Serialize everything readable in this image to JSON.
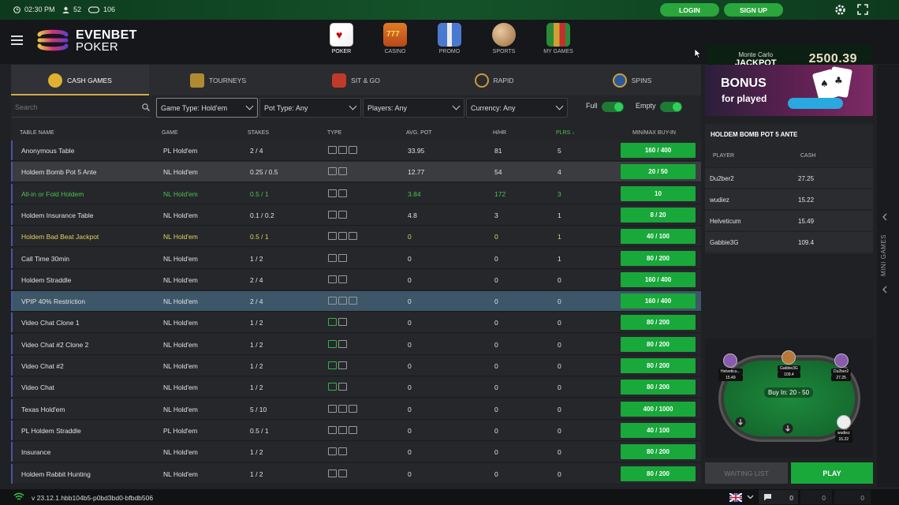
{
  "topbar": {
    "time": "02:30 PM",
    "players": "52",
    "tables": "106",
    "login_label": "LOGIN",
    "signup_label": "SIGN UP"
  },
  "header": {
    "brand_top": "EVENBET",
    "brand_bottom": "POKER",
    "nav": [
      {
        "label": "POKER",
        "icon": "cards-icon"
      },
      {
        "label": "CASINO",
        "icon": "slot-machine-icon"
      },
      {
        "label": "PROMO",
        "icon": "gift-icon"
      },
      {
        "label": "SPORTS",
        "icon": "ball-icon"
      },
      {
        "label": "MY GAMES",
        "icon": "chips-stack-icon"
      }
    ],
    "jackpot": {
      "label_top": "Monte Carlo",
      "label_main": "JACKPOT",
      "value": "2500.39"
    }
  },
  "tabs": [
    {
      "label": "CASH GAMES",
      "icon": "dollar-coin-icon"
    },
    {
      "label": "TOURNEYS",
      "icon": "trophy-icon"
    },
    {
      "label": "SIT & GO",
      "icon": "shield-icon"
    },
    {
      "label": "RAPID",
      "icon": "stopwatch-icon"
    },
    {
      "label": "SPINS",
      "icon": "spin-badge-icon"
    }
  ],
  "filters": {
    "search_placeholder": "Search",
    "game_type": "Game Type: Hold'em",
    "pot_type": "Pot Type: Any",
    "players": "Players: Any",
    "currency": "Currency: Any",
    "full_label": "Full",
    "empty_label": "Empty"
  },
  "columns": [
    "TABLE NAME",
    "GAME",
    "STAKES",
    "TYPE",
    "AVG. POT",
    "H/HR",
    "PLRS ↓",
    "MIN/MAX BUY-IN"
  ],
  "rows": [
    {
      "name": "Anonymous Table",
      "game": "PL Hold'em",
      "stakes": "2 / 4",
      "avg_pot": "33.95",
      "hhr": "81",
      "plrs": "5",
      "buyin": "160 / 400",
      "style": ""
    },
    {
      "name": "Holdem Bomb Pot 5 Ante",
      "game": "NL Hold'em",
      "stakes": "0.25 / 0.5",
      "avg_pot": "12.77",
      "hhr": "54",
      "plrs": "4",
      "buyin": "20 / 50",
      "style": "hl"
    },
    {
      "name": "All-in or Fold Holdem",
      "game": "NL Hold'em",
      "stakes": "0.5 / 1",
      "avg_pot": "3.84",
      "hhr": "172",
      "plrs": "3",
      "buyin": "10",
      "style": "green"
    },
    {
      "name": "Holdem Insurance Table",
      "game": "NL Hold'em",
      "stakes": "0.1 / 0.2",
      "avg_pot": "4.8",
      "hhr": "3",
      "plrs": "1",
      "buyin": "8 / 20",
      "style": ""
    },
    {
      "name": "Holdem Bad Beat Jackpot",
      "game": "NL Hold'em",
      "stakes": "0.5 / 1",
      "avg_pot": "0",
      "hhr": "0",
      "plrs": "1",
      "buyin": "40 / 100",
      "style": "yellow"
    },
    {
      "name": "Call Time 30min",
      "game": "NL Hold'em",
      "stakes": "1 / 2",
      "avg_pot": "0",
      "hhr": "0",
      "plrs": "1",
      "buyin": "80 / 200",
      "style": ""
    },
    {
      "name": "Holdem Straddle",
      "game": "NL Hold'em",
      "stakes": "2 / 4",
      "avg_pot": "0",
      "hhr": "0",
      "plrs": "0",
      "buyin": "160 / 400",
      "style": ""
    },
    {
      "name": "VPIP 40% Restriction",
      "game": "NL Hold'em",
      "stakes": "2 / 4",
      "avg_pot": "0",
      "hhr": "0",
      "plrs": "0",
      "buyin": "160 / 400",
      "style": "sel"
    },
    {
      "name": "Video Chat Clone 1",
      "game": "NL Hold'em",
      "stakes": "1 / 2",
      "avg_pot": "0",
      "hhr": "0",
      "plrs": "0",
      "buyin": "80 / 200",
      "style": ""
    },
    {
      "name": "Video Chat #2 Clone 2",
      "game": "NL Hold'em",
      "stakes": "1 / 2",
      "avg_pot": "0",
      "hhr": "0",
      "plrs": "0",
      "buyin": "80 / 200",
      "style": ""
    },
    {
      "name": "Video Chat #2",
      "game": "NL Hold'em",
      "stakes": "1 / 2",
      "avg_pot": "0",
      "hhr": "0",
      "plrs": "0",
      "buyin": "80 / 200",
      "style": ""
    },
    {
      "name": "Video Chat",
      "game": "NL Hold'em",
      "stakes": "1 / 2",
      "avg_pot": "0",
      "hhr": "0",
      "plrs": "0",
      "buyin": "80 / 200",
      "style": ""
    },
    {
      "name": "Texas Hold'em",
      "game": "NL Hold'em",
      "stakes": "5 / 10",
      "avg_pot": "0",
      "hhr": "0",
      "plrs": "0",
      "buyin": "400 / 1000",
      "style": ""
    },
    {
      "name": "PL Holdem Straddle",
      "game": "PL Hold'em",
      "stakes": "0.5 / 1",
      "avg_pot": "0",
      "hhr": "0",
      "plrs": "0",
      "buyin": "40 / 100",
      "style": ""
    },
    {
      "name": "Insurance",
      "game": "NL Hold'em",
      "stakes": "1 / 2",
      "avg_pot": "0",
      "hhr": "0",
      "plrs": "0",
      "buyin": "80 / 200",
      "style": ""
    },
    {
      "name": "Holdem Rabbit Hunting",
      "game": "NL Hold'em",
      "stakes": "1 / 2",
      "avg_pot": "0",
      "hhr": "0",
      "plrs": "0",
      "buyin": "80 / 200",
      "style": ""
    }
  ],
  "bonus": {
    "line1": "BONUS",
    "line2": "for played"
  },
  "detail": {
    "title": "HOLDEM BOMB POT 5 ANTE",
    "col_player": "PLAYER",
    "col_cash": "CASH",
    "players": [
      {
        "name": "Du2ber2",
        "cash": "27.25"
      },
      {
        "name": "wudiez",
        "cash": "15.22"
      },
      {
        "name": "Helveticum",
        "cash": "15.49"
      },
      {
        "name": "Gabbie3G",
        "cash": "109.4"
      }
    ]
  },
  "preview": {
    "buyin_label": "Buy In: 20 - 50",
    "seats": [
      {
        "name": "Helveticu...",
        "cash": "15.49"
      },
      {
        "name": "Gabbie3G",
        "cash": "109.4"
      },
      {
        "name": "Du2ber2",
        "cash": "27.25"
      },
      {
        "name": "wudiez",
        "cash": "15.22"
      }
    ]
  },
  "actions": {
    "waiting_list": "WAITING LIST",
    "play": "PLAY"
  },
  "side": {
    "mini_games": "MINI GAMES"
  },
  "footer": {
    "version": "v 23.12.1.hbb104b5-p0bd3bd0-bfbdb506",
    "chat_count": "0",
    "count2": "0",
    "count3": "0"
  }
}
